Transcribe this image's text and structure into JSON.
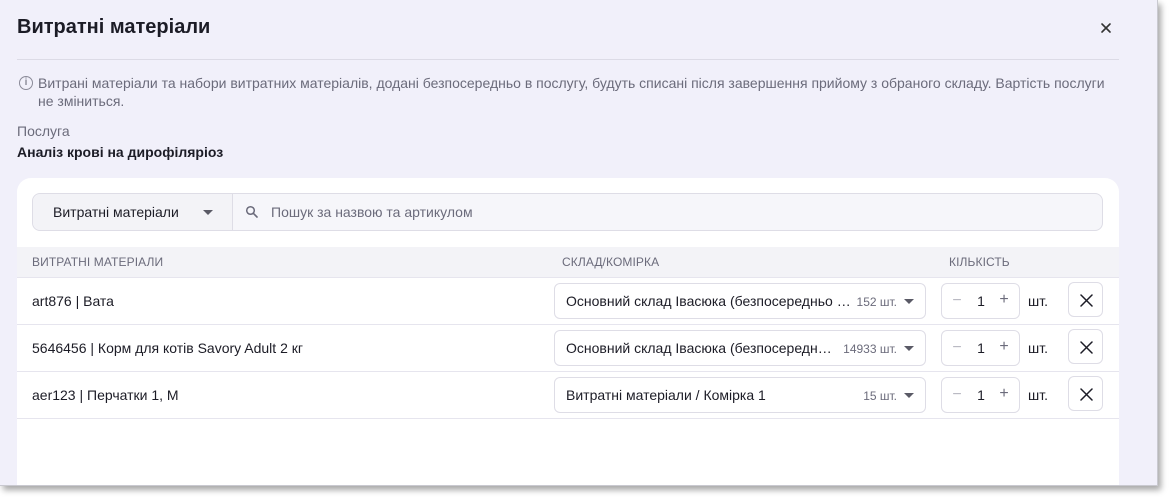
{
  "dialog": {
    "title": "Витратні матеріали",
    "close_icon": "close-icon"
  },
  "info": {
    "icon": "info-icon",
    "text": "Витрані матеріали та набори витратних матеріалів, додані безпосередньо в послугу, будуть списані після завершення прийому з обраного складу. Вартість послуги не зміниться."
  },
  "service": {
    "label": "Послуга",
    "name": "Аналіз крові на дирофіляріоз"
  },
  "filter": {
    "select_label": "Витратні матеріали",
    "search_placeholder": "Пошук за назвою та артикулом",
    "search_icon": "search-icon"
  },
  "table": {
    "headers": {
      "materials": "ВИТРАТНІ МАТЕРІАЛИ",
      "warehouse": "СКЛАД/КОМІРКА",
      "quantity": "КІЛЬКІСТЬ"
    },
    "rows": [
      {
        "name": "art876 | Вата",
        "warehouse": "Основний склад Івасюка (безпосередньо в кабінеті)",
        "stock": "152 шт.",
        "minus": "−",
        "qty": "1",
        "plus": "+",
        "unit": "шт."
      },
      {
        "name": "5646456 | Корм для котів Savory Adult 2 кг",
        "warehouse": "Основний склад Івасюка (безпосередньо в кабінеті)",
        "stock": "14933 шт.",
        "minus": "−",
        "qty": "1",
        "plus": "+",
        "unit": "шт."
      },
      {
        "name": "aer123 | Перчатки 1, M",
        "warehouse": "Витратні матеріали / Комірка 1",
        "stock": "15 шт.",
        "minus": "−",
        "qty": "1",
        "plus": "+",
        "unit": "шт."
      }
    ]
  }
}
